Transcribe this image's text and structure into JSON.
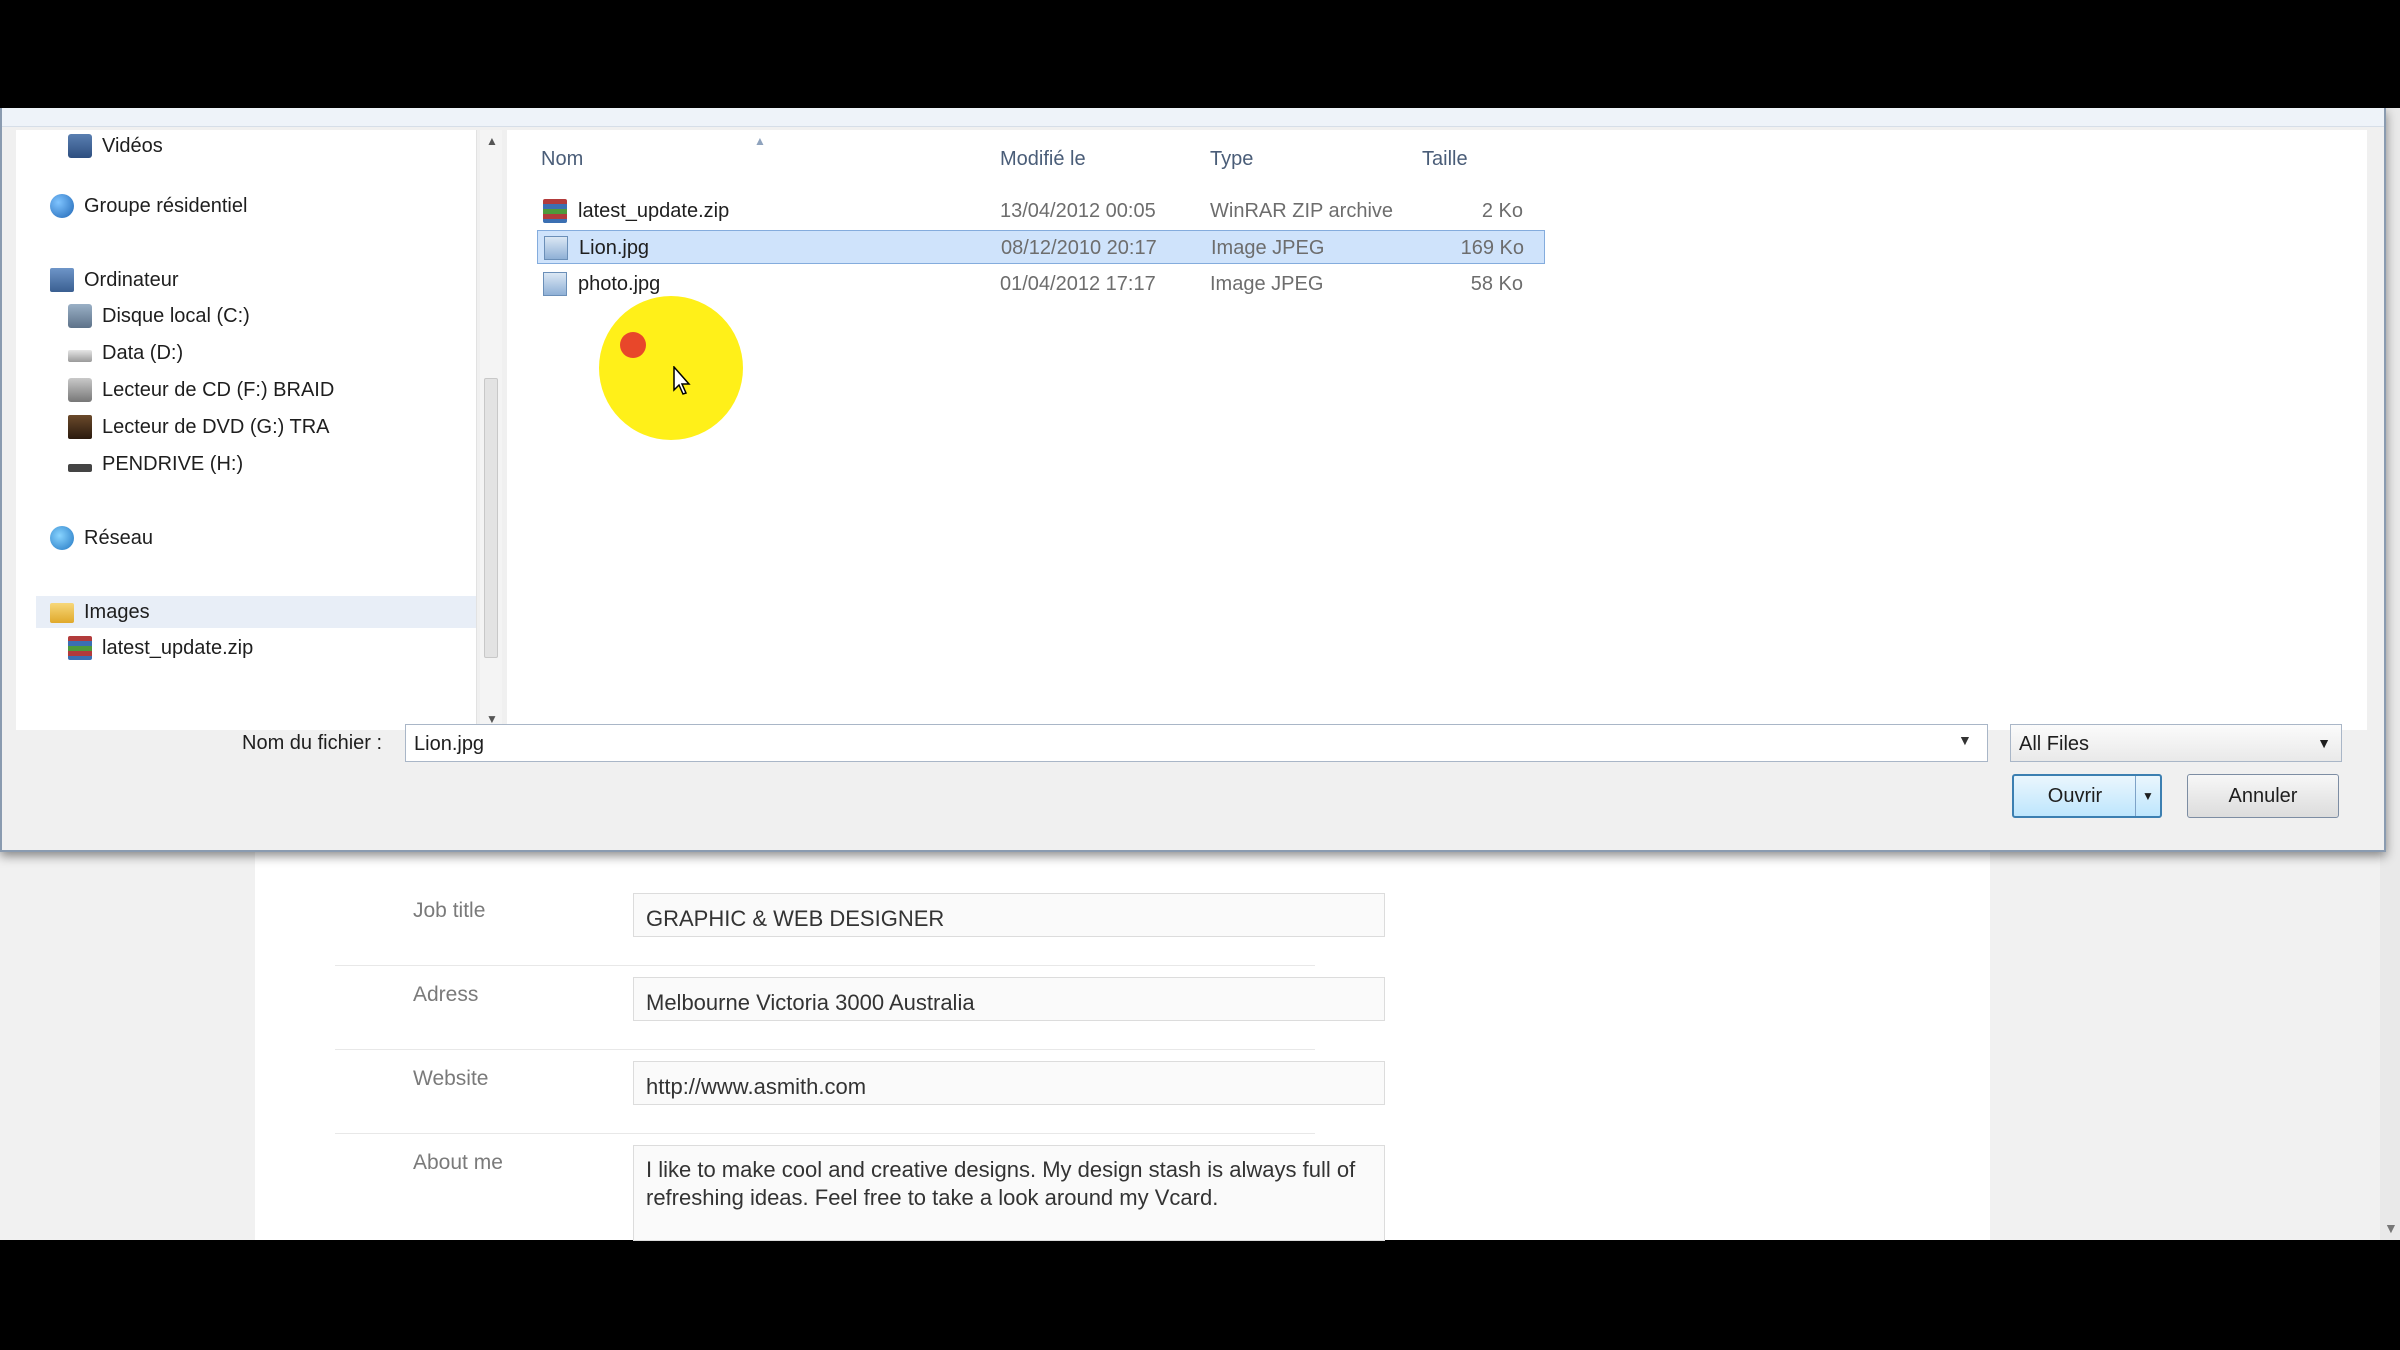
{
  "sidebar": {
    "items": [
      {
        "label": "Vidéos",
        "icon": "videos-icon"
      },
      {
        "label": "Groupe résidentiel",
        "icon": "homegroup-icon"
      },
      {
        "label": "Ordinateur",
        "icon": "computer-icon"
      },
      {
        "label": "Disque local (C:)",
        "icon": "disk-icon"
      },
      {
        "label": "Data (D:)",
        "icon": "drive-icon"
      },
      {
        "label": "Lecteur de CD (F:) BRAID",
        "icon": "cd-drive-icon"
      },
      {
        "label": "Lecteur de DVD (G:) TRA",
        "icon": "dvd-drive-icon"
      },
      {
        "label": "PENDRIVE (H:)",
        "icon": "usb-drive-icon"
      },
      {
        "label": "Réseau",
        "icon": "network-icon"
      },
      {
        "label": "Images",
        "icon": "folder-icon"
      },
      {
        "label": "latest_update.zip",
        "icon": "zip-icon"
      }
    ]
  },
  "file_list": {
    "columns": {
      "name": "Nom",
      "modified": "Modifié le",
      "type": "Type",
      "size": "Taille"
    },
    "files": [
      {
        "name": "latest_update.zip",
        "modified": "13/04/2012 00:05",
        "type": "WinRAR ZIP archive",
        "size": "2 Ko",
        "icon": "zip-icon"
      },
      {
        "name": "Lion.jpg",
        "modified": "08/12/2010 20:17",
        "type": "Image JPEG",
        "size": "169 Ko",
        "icon": "image-icon",
        "selected": true
      },
      {
        "name": "photo.jpg",
        "modified": "01/04/2012 17:17",
        "type": "Image JPEG",
        "size": "58 Ko",
        "icon": "image-icon"
      }
    ]
  },
  "footer": {
    "filename_label": "Nom du fichier :",
    "filename_value": "Lion.jpg",
    "filter_value": "All Files",
    "open_label": "Ouvrir",
    "cancel_label": "Annuler"
  },
  "form": {
    "fields": [
      {
        "label": "Job title",
        "value": "GRAPHIC & WEB DESIGNER"
      },
      {
        "label": "Adress",
        "value": "Melbourne Victoria 3000 Australia"
      },
      {
        "label": "Website",
        "value": "http://www.asmith.com"
      },
      {
        "label": "About me",
        "value": "I like to make cool and creative designs. My design stash is always full of refreshing ideas. Feel free to take a look around my Vcard."
      }
    ]
  },
  "colors": {
    "selection": "#cfe3fb",
    "highlight": "#ffee00",
    "click_dot": "#e8472a"
  }
}
